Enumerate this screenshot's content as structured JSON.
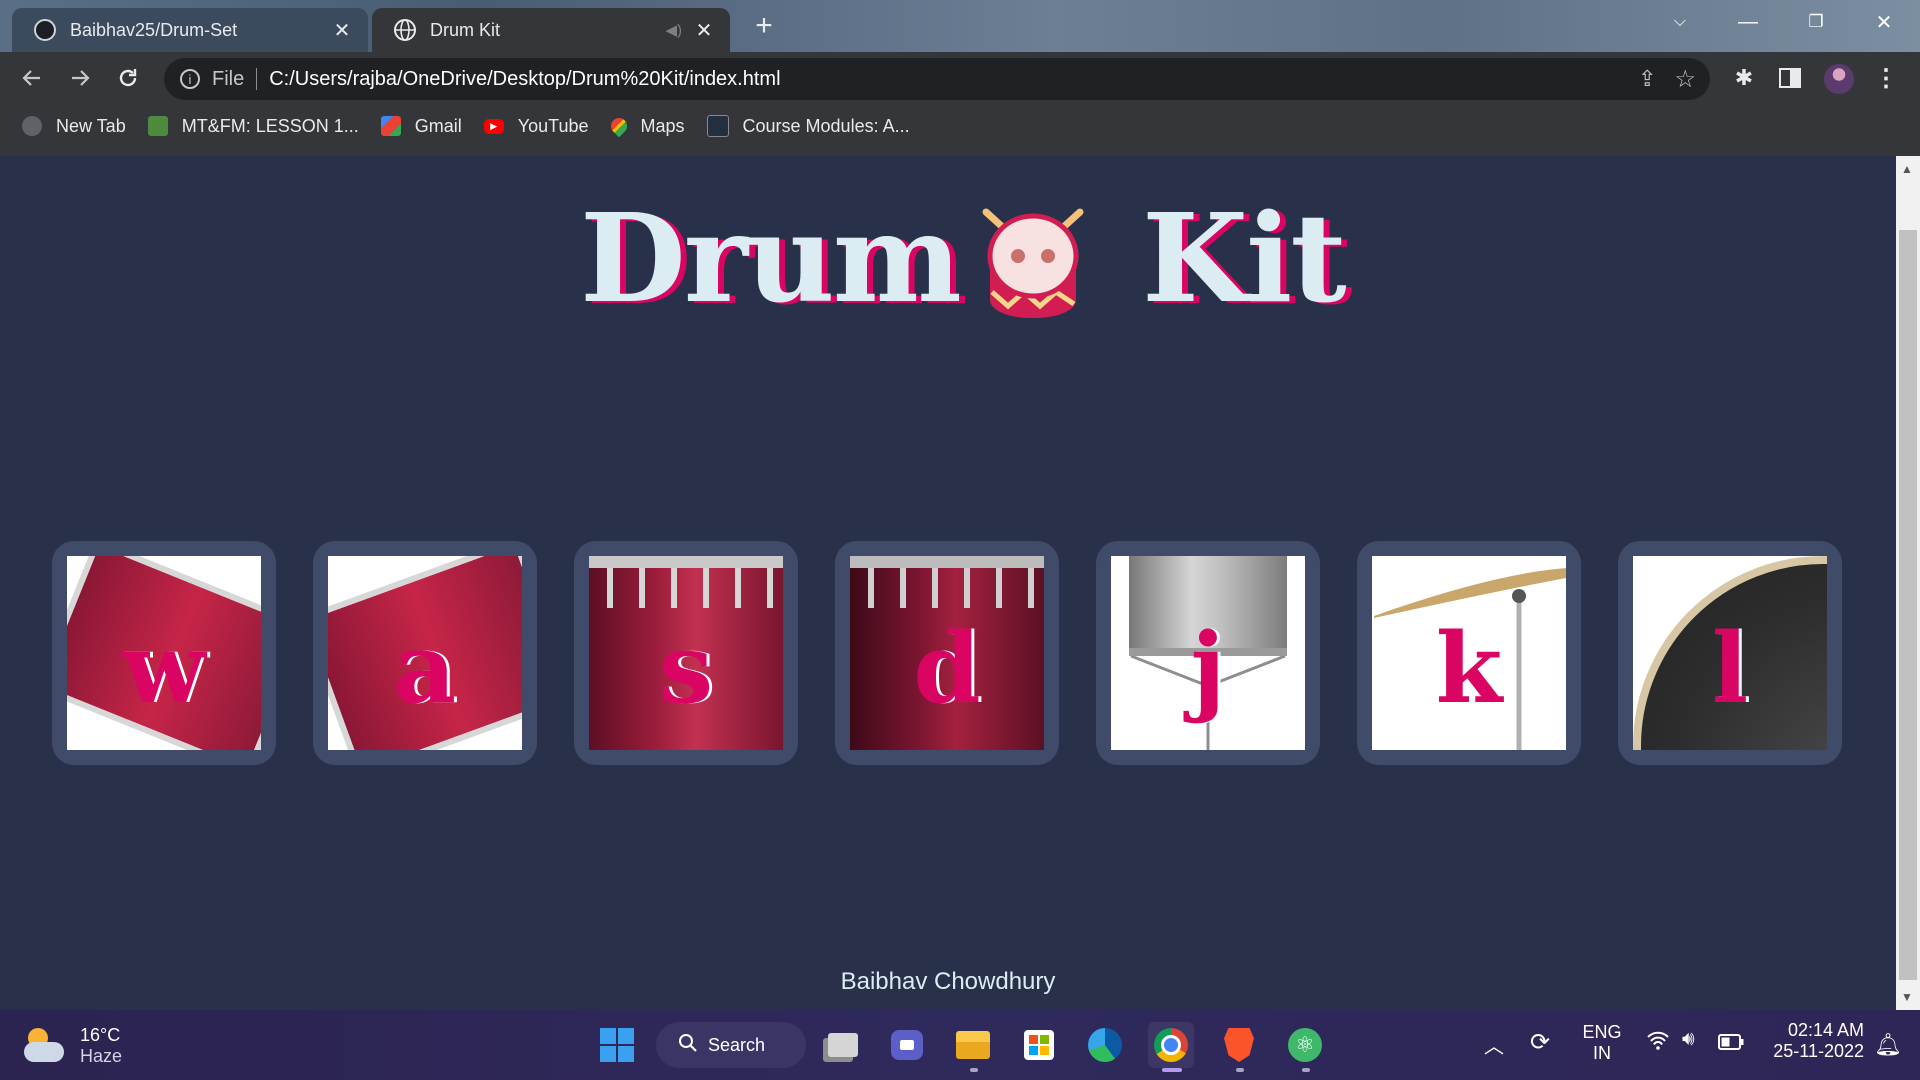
{
  "browser": {
    "tabs": [
      {
        "title": "Baibhav25/Drum-Set",
        "favicon": "github-icon",
        "active": false
      },
      {
        "title": "Drum Kit",
        "favicon": "globe-icon",
        "active": true,
        "muted_icon": "speaker-icon"
      }
    ],
    "new_tab_symbol": "+",
    "url_scheme_label": "File",
    "url": "C:/Users/rajba/OneDrive/Desktop/Drum%20Kit/index.html",
    "bookmarks": [
      {
        "label": "New Tab",
        "icon": "globe-icon",
        "color": "#5f6368"
      },
      {
        "label": "MT&FM: LESSON 1...",
        "icon": "document-icon",
        "color": "#4e8a3e"
      },
      {
        "label": "Gmail",
        "icon": "gmail-icon",
        "color": "#ea4335"
      },
      {
        "label": "YouTube",
        "icon": "youtube-icon",
        "color": "#ff0000"
      },
      {
        "label": "Maps",
        "icon": "maps-icon",
        "color": "#34a853"
      },
      {
        "label": "Course Modules: A...",
        "icon": "aws-icon",
        "color": "#232f3e"
      }
    ]
  },
  "page": {
    "title_left": "Drum",
    "title_right": "Kit",
    "drums": [
      {
        "key": "w",
        "image": "tom-1"
      },
      {
        "key": "a",
        "image": "tom-2"
      },
      {
        "key": "s",
        "image": "tom-3"
      },
      {
        "key": "d",
        "image": "tom-4"
      },
      {
        "key": "j",
        "image": "snare"
      },
      {
        "key": "k",
        "image": "crash"
      },
      {
        "key": "l",
        "image": "kick"
      }
    ],
    "footer": "Baibhav Chowdhury",
    "colors": {
      "background": "#283149",
      "card": "#404b69",
      "accent": "#da0463",
      "text": "#dbedf3"
    }
  },
  "taskbar": {
    "weather": {
      "temp": "16°C",
      "condition": "Haze"
    },
    "search_label": "Search",
    "language": {
      "line1": "ENG",
      "line2": "IN"
    },
    "clock": {
      "time": "02:14 AM",
      "date": "25-11-2022"
    }
  }
}
